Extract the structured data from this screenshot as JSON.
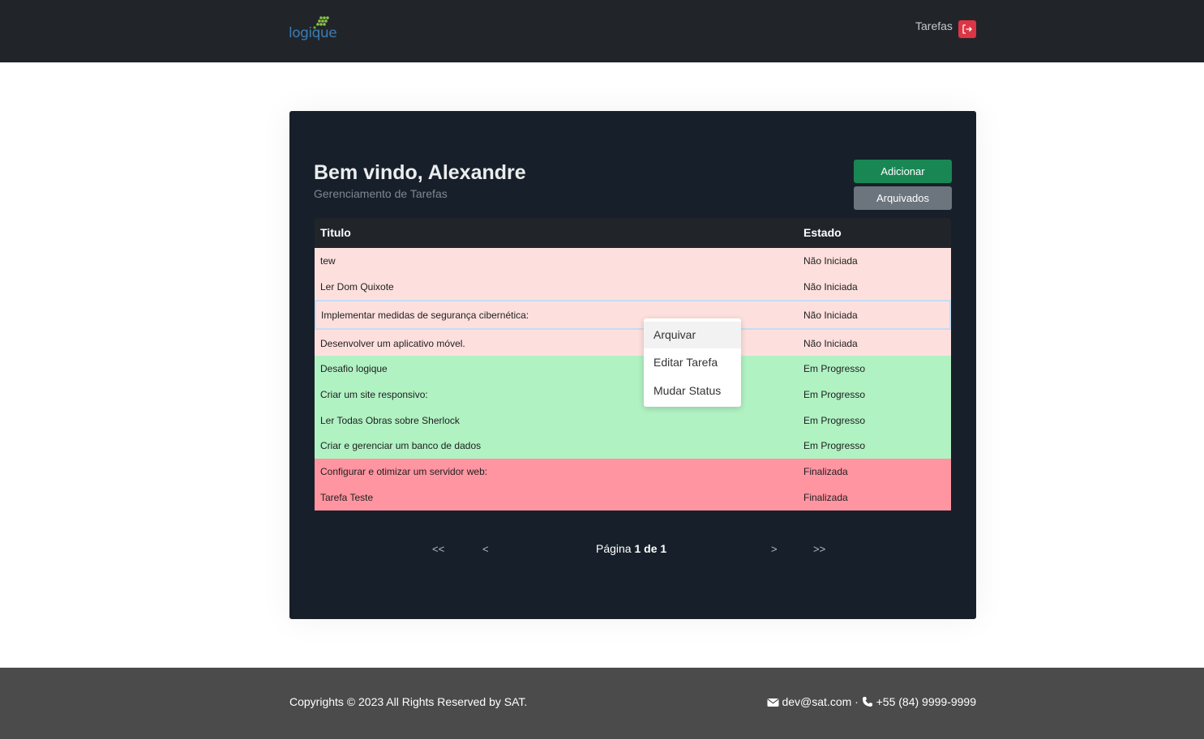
{
  "navbar": {
    "logo_text": "logique",
    "nav_link": "Tarefas",
    "logout_icon": "logout-icon",
    "colors": {
      "background": "#212529",
      "logout": "#dc3545",
      "logo": "#3b7db8",
      "logo_dots": "#8bc34a"
    }
  },
  "main": {
    "welcome_title": "Bem vindo, Alexandre",
    "subtitle": "Gerenciamento de Tarefas",
    "add_button": "Adicionar",
    "archived_button": "Arquivados",
    "table": {
      "columns": [
        "Titulo",
        "Estado"
      ],
      "rows": [
        {
          "title": "tew",
          "status": "Não Iniciada"
        },
        {
          "title": "Ler Dom Quixote",
          "status": "Não Iniciada"
        },
        {
          "title": "Implementar medidas de segurança cibernética:",
          "status": "Não Iniciada"
        },
        {
          "title": "Desenvolver um aplicativo móvel.",
          "status": "Não Iniciada"
        },
        {
          "title": "Desafio logique",
          "status": "Em Progresso"
        },
        {
          "title": "Criar um site responsivo:",
          "status": "Em Progresso"
        },
        {
          "title": "Ler Todas Obras sobre Sherlock",
          "status": "Em Progresso"
        },
        {
          "title": "Criar e gerenciar um banco de dados",
          "status": "Em Progresso"
        },
        {
          "title": "Configurar e otimizar um servidor web:",
          "status": "Finalizada"
        },
        {
          "title": "Tarefa Teste",
          "status": "Finalizada"
        }
      ]
    },
    "context_menu": {
      "items": [
        "Arquivar",
        "Editar Tarefa",
        "Mudar Status"
      ]
    },
    "pagination": {
      "first": "<<",
      "prev": "<",
      "next": ">",
      "last": ">>",
      "label": "Página",
      "current": "1",
      "separator": "de",
      "total": "1"
    },
    "colors": {
      "card": "#17202a",
      "add_button": "#198754",
      "archived_button": "#6c757d",
      "not_started": "#fde0de",
      "in_progress": "#b1f2c3",
      "finished": "#ff95a1"
    }
  },
  "footer": {
    "copyright": "Copyrights © 2023 All Rights Reserved by SAT.",
    "email": "dev@sat.com",
    "separator": "·",
    "phone": "+55 (84) 9999-9999",
    "email_icon": "envelope-icon",
    "phone_icon": "phone-icon"
  }
}
